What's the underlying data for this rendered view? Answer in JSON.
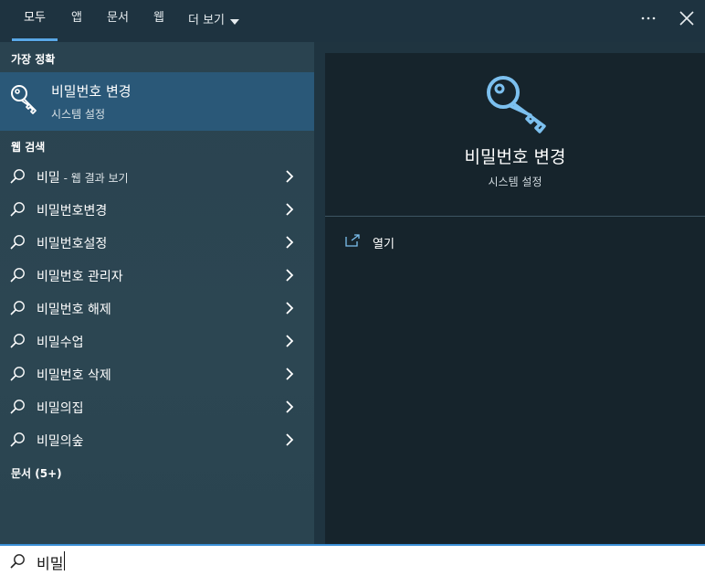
{
  "tabs": [
    {
      "label": "모두",
      "active": true
    },
    {
      "label": "앱",
      "active": false
    },
    {
      "label": "문서",
      "active": false
    },
    {
      "label": "웹",
      "active": false
    },
    {
      "label": "더 보기",
      "active": false
    }
  ],
  "top_icons": {
    "more": "more-options-icon",
    "close": "close-icon"
  },
  "left": {
    "best_match_header": "가장 정확",
    "best_match": {
      "title": "비밀번호 변경",
      "subtitle": "시스템 설정",
      "icon": "key-icon"
    },
    "web_search_header": "웹 검색",
    "results": [
      {
        "label": "비밀",
        "suffix": " - 웹 결과 보기"
      },
      {
        "label": "비밀번호변경",
        "suffix": ""
      },
      {
        "label": "비밀번호설정",
        "suffix": ""
      },
      {
        "label": "비밀번호 관리자",
        "suffix": ""
      },
      {
        "label": "비밀번호 해제",
        "suffix": ""
      },
      {
        "label": "비밀수업",
        "suffix": ""
      },
      {
        "label": "비밀번호 삭제",
        "suffix": ""
      },
      {
        "label": "비밀의집",
        "suffix": ""
      },
      {
        "label": "비밀의숲",
        "suffix": ""
      }
    ],
    "documents_header": "문서 (5+)"
  },
  "right": {
    "title": "비밀번호 변경",
    "subtitle": "시스템 설정",
    "actions": [
      {
        "label": "열기",
        "icon": "open-icon"
      }
    ]
  },
  "search": {
    "value": "비밀",
    "icon": "search-icon"
  },
  "colors": {
    "accent": "#59a7e6",
    "selected": "#2a5878",
    "left_bg": "#2a4350",
    "right_bg": "#16242c"
  }
}
